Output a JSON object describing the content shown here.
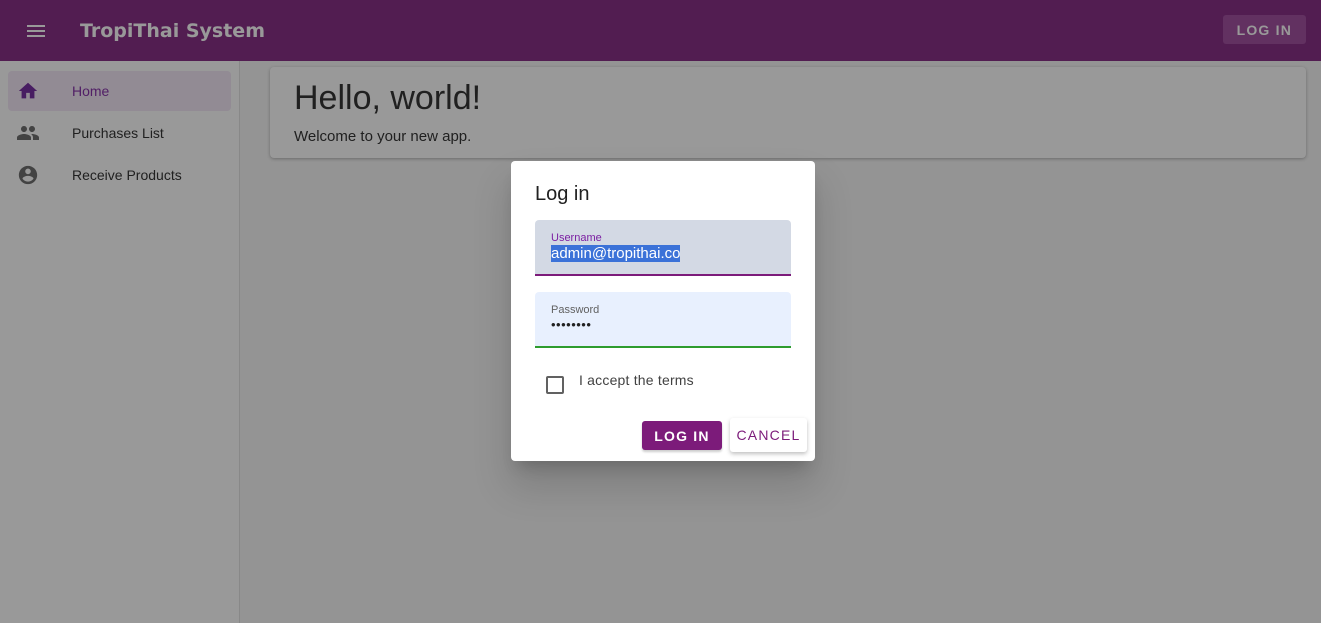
{
  "colors": {
    "primary": "#7c1b7a",
    "nav_active_bg": "#f3e5f5",
    "nav_active_text": "#7b1fa2",
    "selection": "#3b72d8",
    "valid_underline": "#2e9c2e"
  },
  "appbar": {
    "menu_icon": "menu-icon",
    "title": "TropiThai System",
    "login_label": "LOG IN"
  },
  "sidebar": {
    "items": [
      {
        "icon": "home-icon",
        "label": "Home",
        "active": true
      },
      {
        "icon": "people-icon",
        "label": "Purchases List",
        "active": false
      },
      {
        "icon": "account-circle-icon",
        "label": "Receive Products",
        "active": false
      }
    ]
  },
  "main": {
    "title": "Hello, world!",
    "subtitle": "Welcome to your new app."
  },
  "dialog": {
    "title": "Log in",
    "username": {
      "label": "Username",
      "value": "admin@tropithai.co"
    },
    "password": {
      "label": "Password",
      "value": "••••••••"
    },
    "terms": {
      "label": "I accept the terms",
      "checked": false
    },
    "login_label": "LOG IN",
    "cancel_label": "CANCEL"
  }
}
